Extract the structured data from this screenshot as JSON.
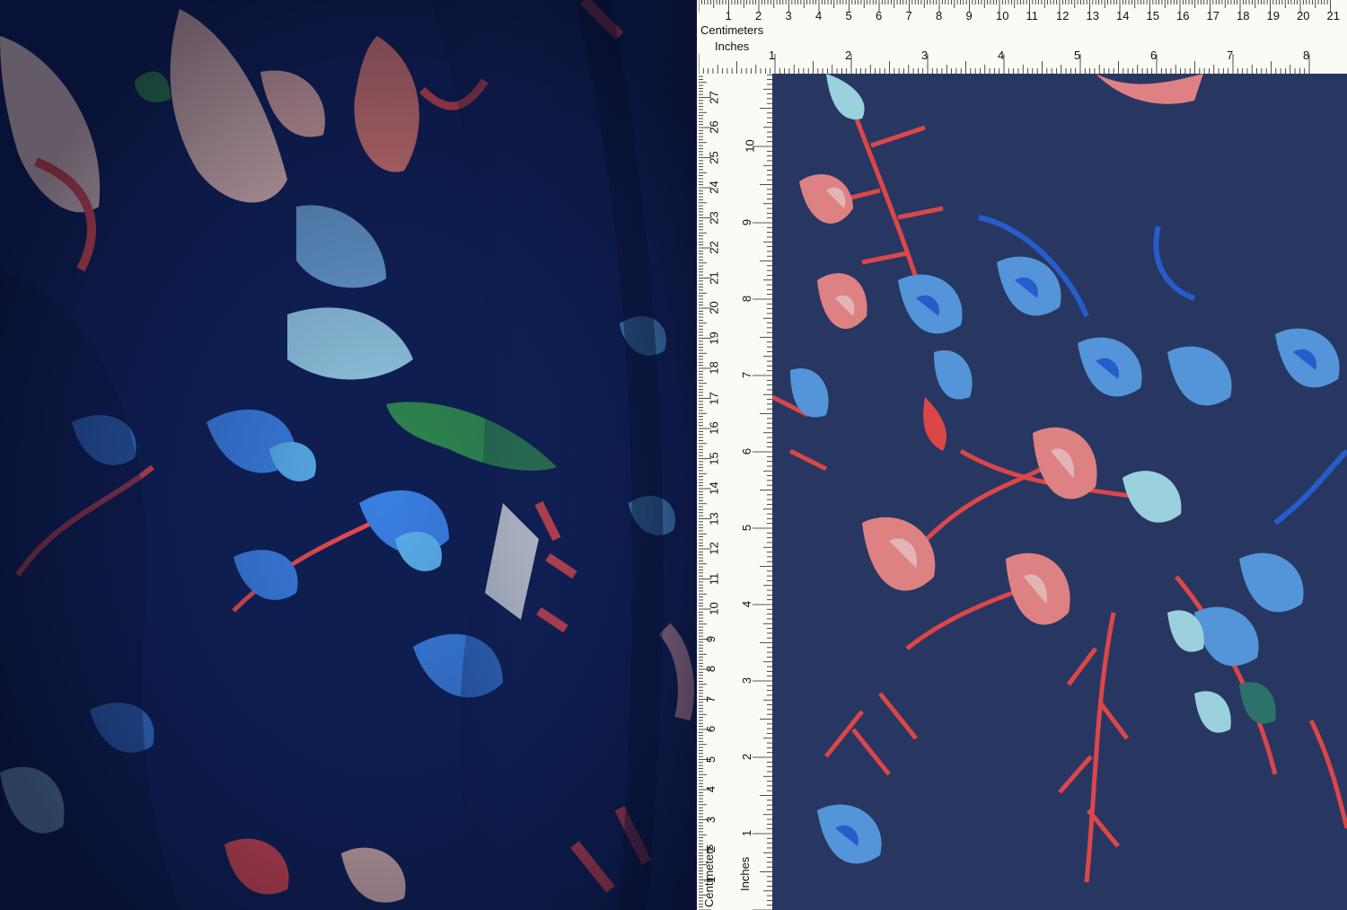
{
  "ruler": {
    "cm_label": "Centimeters",
    "in_label": "Inches",
    "top_cm": [
      "1",
      "2",
      "3",
      "4",
      "5",
      "6",
      "7",
      "8",
      "9",
      "10",
      "11",
      "12",
      "13",
      "14",
      "15",
      "16",
      "17",
      "18",
      "19",
      "20",
      "21"
    ],
    "top_in": [
      "1",
      "2",
      "3",
      "4",
      "5",
      "6",
      "7",
      "8"
    ],
    "side_cm": [
      "27",
      "26",
      "25",
      "24",
      "23",
      "22",
      "21",
      "20",
      "19",
      "18",
      "17",
      "16",
      "15",
      "14",
      "13",
      "12",
      "11",
      "10",
      "9",
      "8",
      "7",
      "6",
      "5",
      "4",
      "3",
      "2",
      "1"
    ],
    "side_in": [
      "10",
      "9",
      "8",
      "7",
      "6",
      "5",
      "4",
      "3",
      "2",
      "1"
    ]
  },
  "colors": {
    "navy": "#0e1d4f",
    "denim": "#2a3a66",
    "coral": "#ef5a5a",
    "pink": "#f3a8a8",
    "sky_blue": "#5aa0e6",
    "royal_blue": "#2a63d8",
    "green": "#2f8a4a"
  }
}
